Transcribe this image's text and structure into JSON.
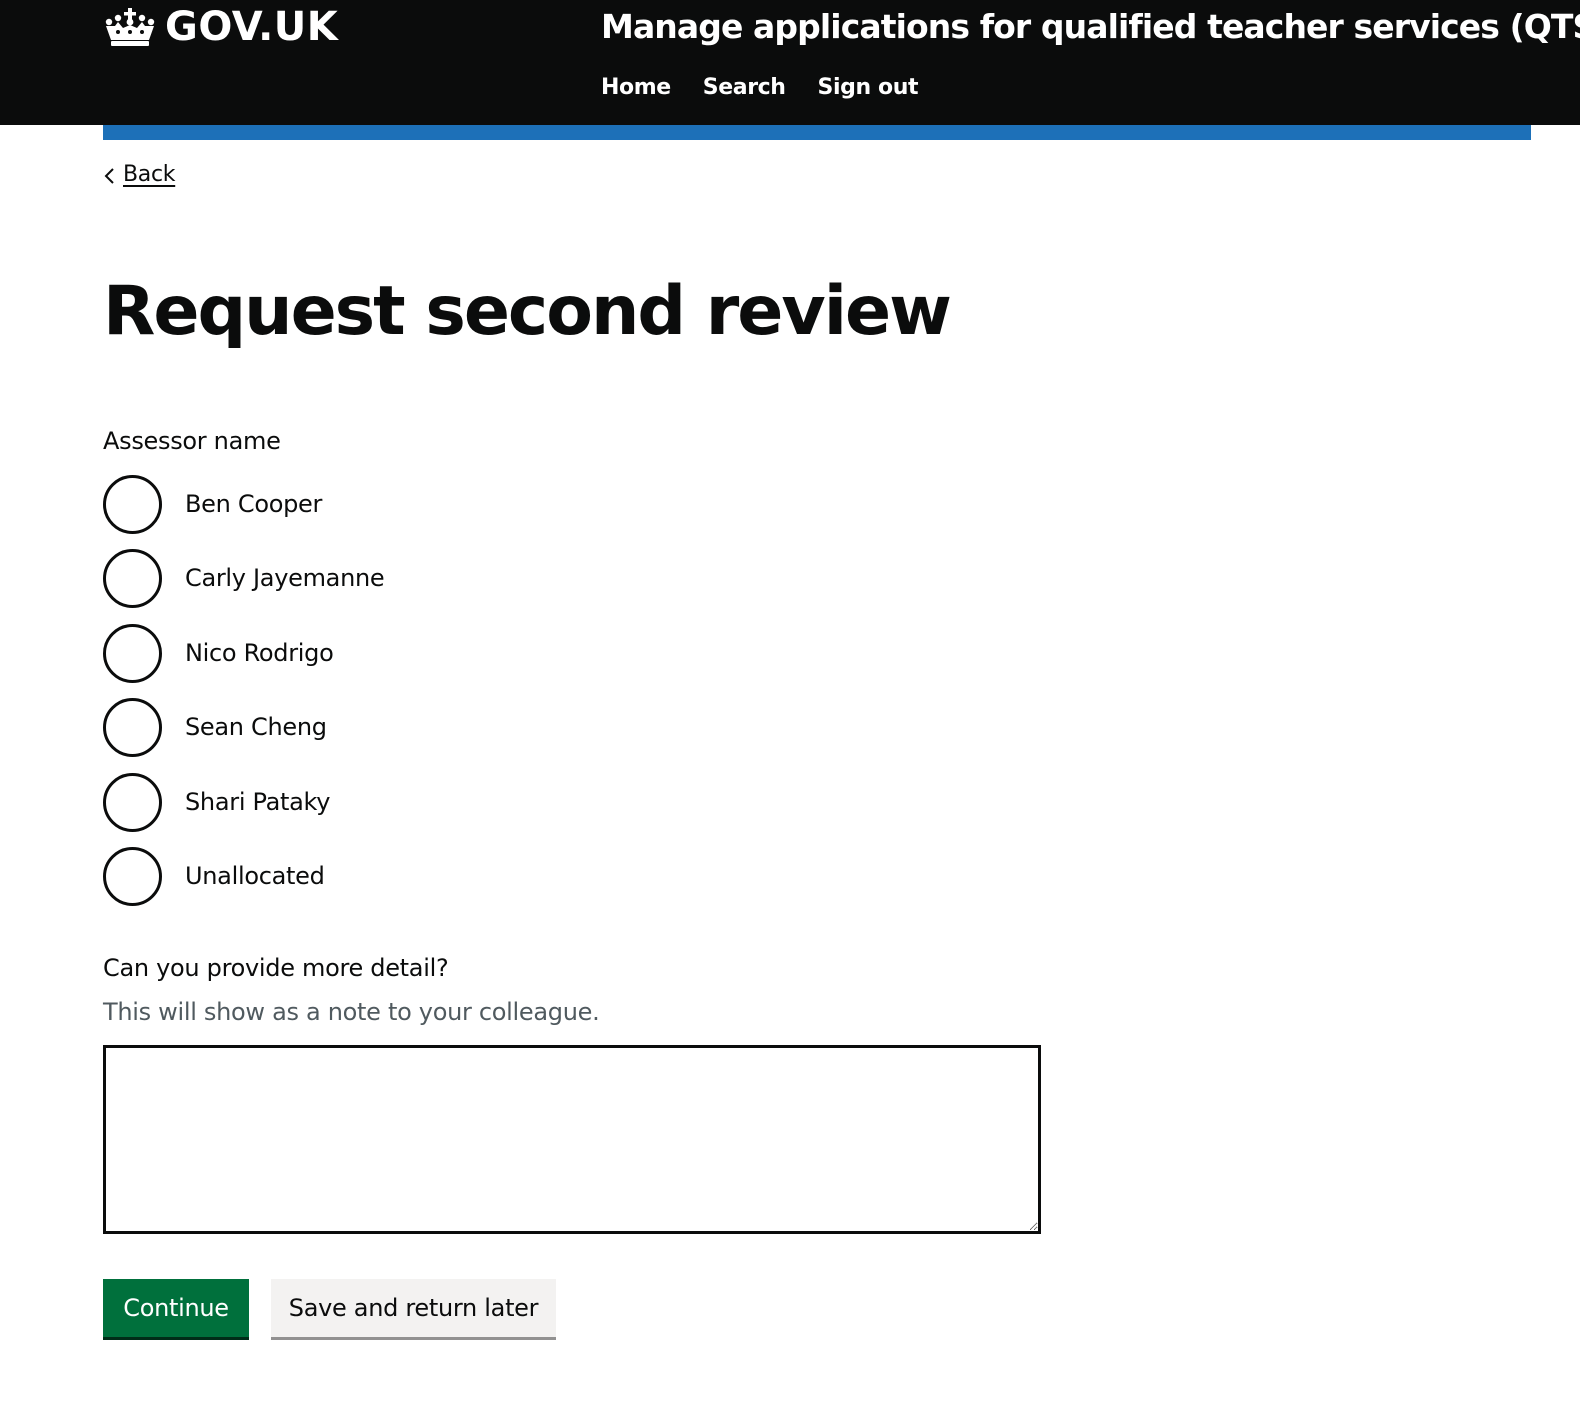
{
  "header": {
    "logo_text": "GOV.UK",
    "service_name": "Manage applications for qualified teacher services (QTS)",
    "nav": [
      {
        "label": "Home"
      },
      {
        "label": "Search"
      },
      {
        "label": "Sign out"
      }
    ]
  },
  "back_link": {
    "label": "Back"
  },
  "page": {
    "title": "Request second review"
  },
  "assessor": {
    "legend": "Assessor name",
    "options": [
      {
        "label": "Ben Cooper",
        "checked": false
      },
      {
        "label": "Carly Jayemanne",
        "checked": false
      },
      {
        "label": "Nico Rodrigo",
        "checked": false
      },
      {
        "label": "Sean Cheng",
        "checked": false
      },
      {
        "label": "Shari Pataky",
        "checked": false
      },
      {
        "label": "Unallocated",
        "checked": false
      }
    ]
  },
  "detail": {
    "label": "Can you provide more detail?",
    "hint": "This will show as a note to your colleague.",
    "value": ""
  },
  "buttons": {
    "continue": "Continue",
    "save_later": "Save and return later"
  },
  "colors": {
    "header_bg": "#0b0c0c",
    "accent_bar": "#1d70b8",
    "primary_button": "#00703c",
    "secondary_button": "#f3f2f1",
    "hint_text": "#505a5f"
  }
}
